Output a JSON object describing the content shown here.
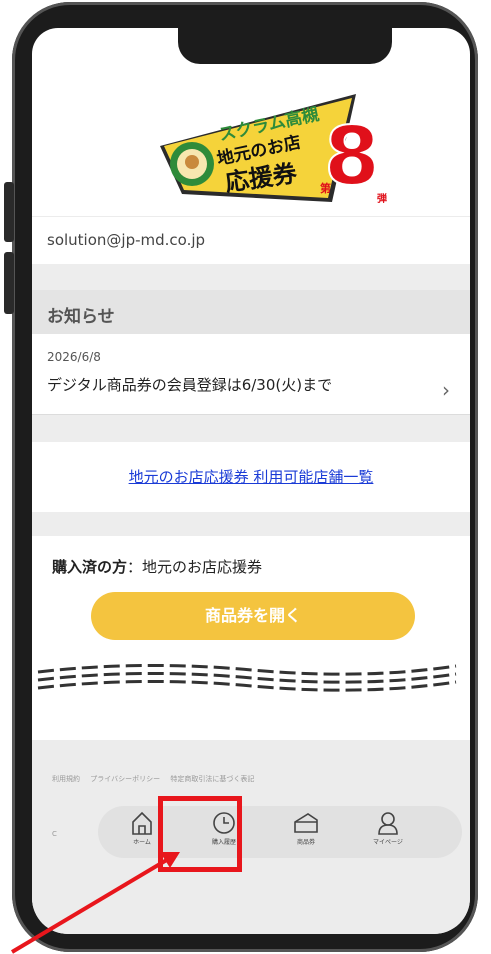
{
  "logo": {
    "line1": "スクラム高槻",
    "line2": "地元のお店",
    "line3": "応援券",
    "number": "8",
    "dai": "第",
    "dan": "弾"
  },
  "account": {
    "email": "solution@jp-md.co.jp"
  },
  "notices": {
    "heading": "お知らせ",
    "items": [
      {
        "date": "2026/6/8",
        "title": "デジタル商品券の会員登録は6/30(火)まで"
      }
    ]
  },
  "stores_link": "地元のお店応援券 利用可能店舗一覧",
  "purchase": {
    "label_bold": "購入済の方",
    "label_rest": "：地元のお店応援券",
    "open_button": "商品券を開く"
  },
  "footer": {
    "links": [
      "利用規約",
      "プライバシーポリシー",
      "特定商取引法に基づく表記"
    ],
    "copyright": "C"
  },
  "tabbar": {
    "items": [
      {
        "label": "ホーム",
        "icon": "home-icon"
      },
      {
        "label": "購入履歴",
        "icon": "clock-icon"
      },
      {
        "label": "商品券",
        "icon": "ticket-icon"
      },
      {
        "label": "マイページ",
        "icon": "person-icon"
      }
    ]
  },
  "colors": {
    "accent": "#f4c43f",
    "link": "#1a3bd6",
    "highlight": "#e8161c",
    "logo_yellow": "#f5d33a",
    "logo_red": "#e0101a",
    "logo_green": "#2e8b3a"
  }
}
